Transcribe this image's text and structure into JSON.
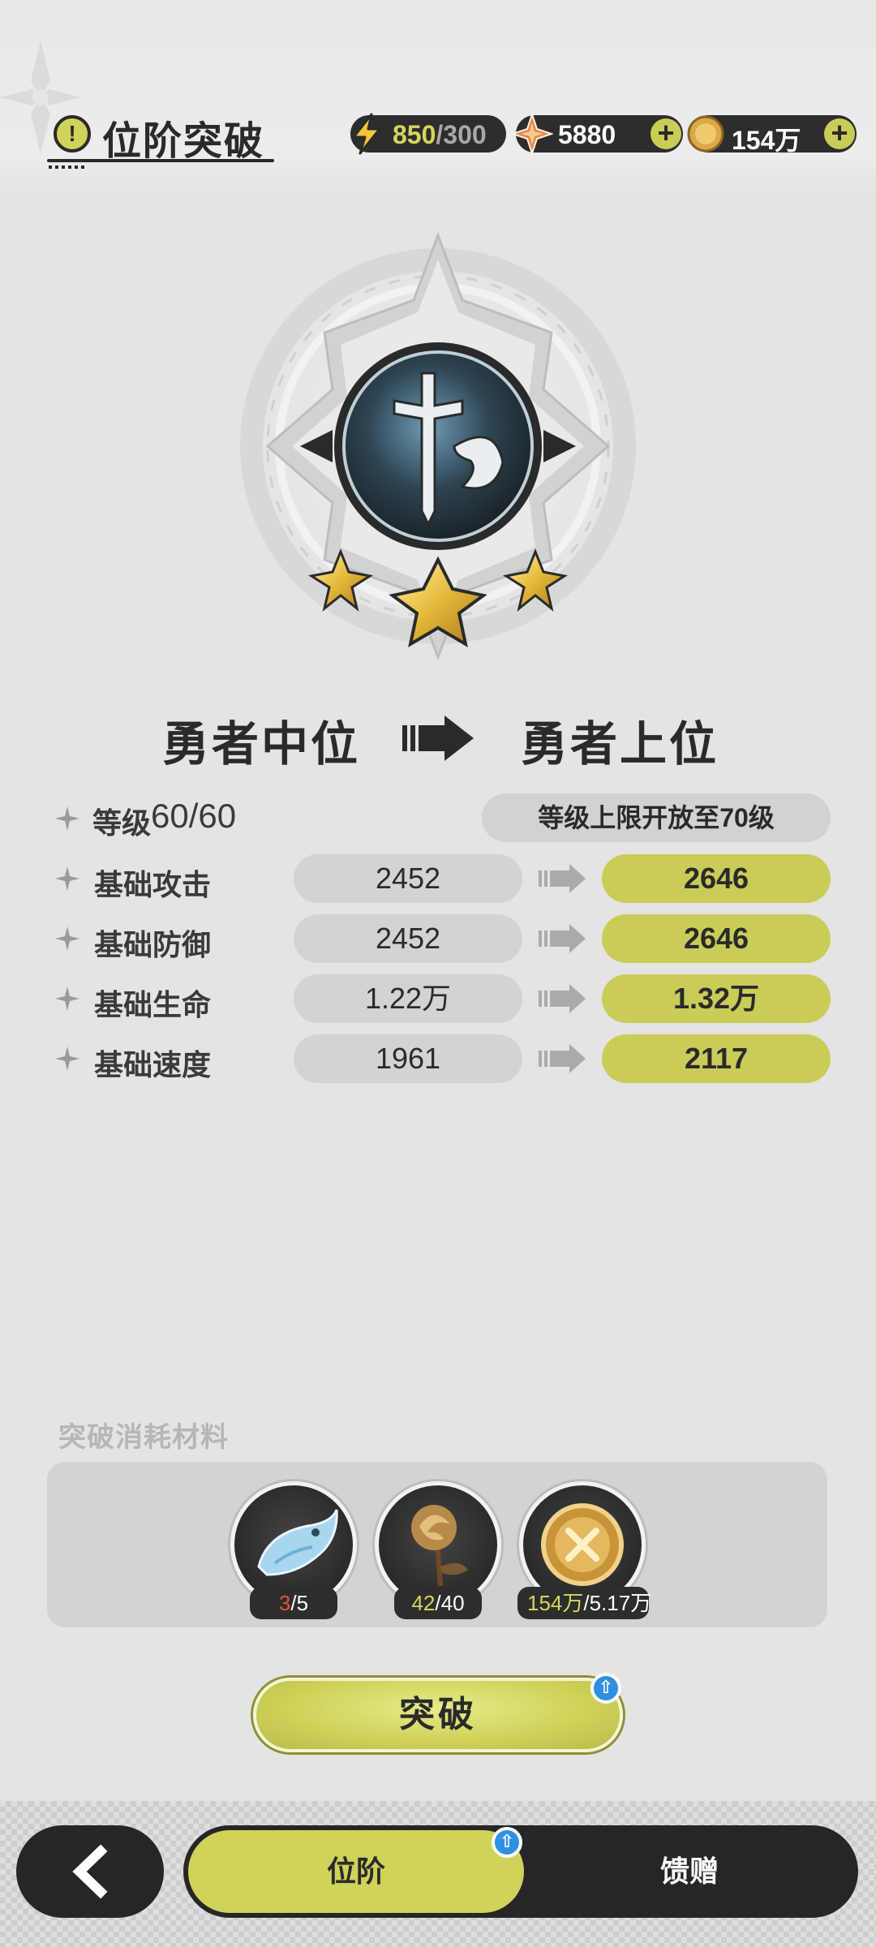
{
  "header": {
    "title": "位阶突破",
    "title_icon": "exclamation-icon",
    "resources": {
      "stamina": {
        "icon": "lightning-icon",
        "current": "850",
        "separator": "/",
        "max": "300"
      },
      "crystal": {
        "icon": "crystal-icon",
        "value": "5880",
        "plus_icon": "plus-icon"
      },
      "coin": {
        "icon": "coin-icon",
        "value": "154万",
        "plus_icon": "plus-icon"
      }
    }
  },
  "emblem": {
    "icon": "sword-rank-emblem-icon",
    "stars": 3
  },
  "rank": {
    "current": "勇者中位",
    "next": "勇者上位",
    "arrow_icon": "arrow-right-icon"
  },
  "level": {
    "label": "等级",
    "value": "60/60",
    "cap_note": "等级上限开放至70级"
  },
  "stats": [
    {
      "label": "基础攻击",
      "old": "2452",
      "new": "2646"
    },
    {
      "label": "基础防御",
      "old": "2452",
      "new": "2646"
    },
    {
      "label": "基础生命",
      "old": "1.22万",
      "new": "1.32万"
    },
    {
      "label": "基础速度",
      "old": "1961",
      "new": "2117"
    }
  ],
  "materials": {
    "title": "突破消耗材料",
    "items": [
      {
        "icon": "blue-fish-material-icon",
        "have": "3",
        "sep": "/",
        "need": "5",
        "sufficient": false
      },
      {
        "icon": "golden-rose-material-icon",
        "have": "42",
        "sep": "/",
        "need": "40",
        "sufficient": true
      },
      {
        "icon": "gold-coin-material-icon",
        "have": "154万",
        "sep": "/",
        "need": "5.17万",
        "sufficient": true
      }
    ]
  },
  "actions": {
    "break_label": "突破"
  },
  "bottom_nav": {
    "back_icon": "back-arrow-icon",
    "tabs": [
      {
        "label": "位阶",
        "active": true
      },
      {
        "label": "馈赠",
        "active": false
      }
    ]
  },
  "colors": {
    "accent": "#cfd35a",
    "dark": "#262626",
    "background": "#e4e4e4",
    "insufficient": "#e2533a",
    "badge": "#2f8fe0"
  }
}
